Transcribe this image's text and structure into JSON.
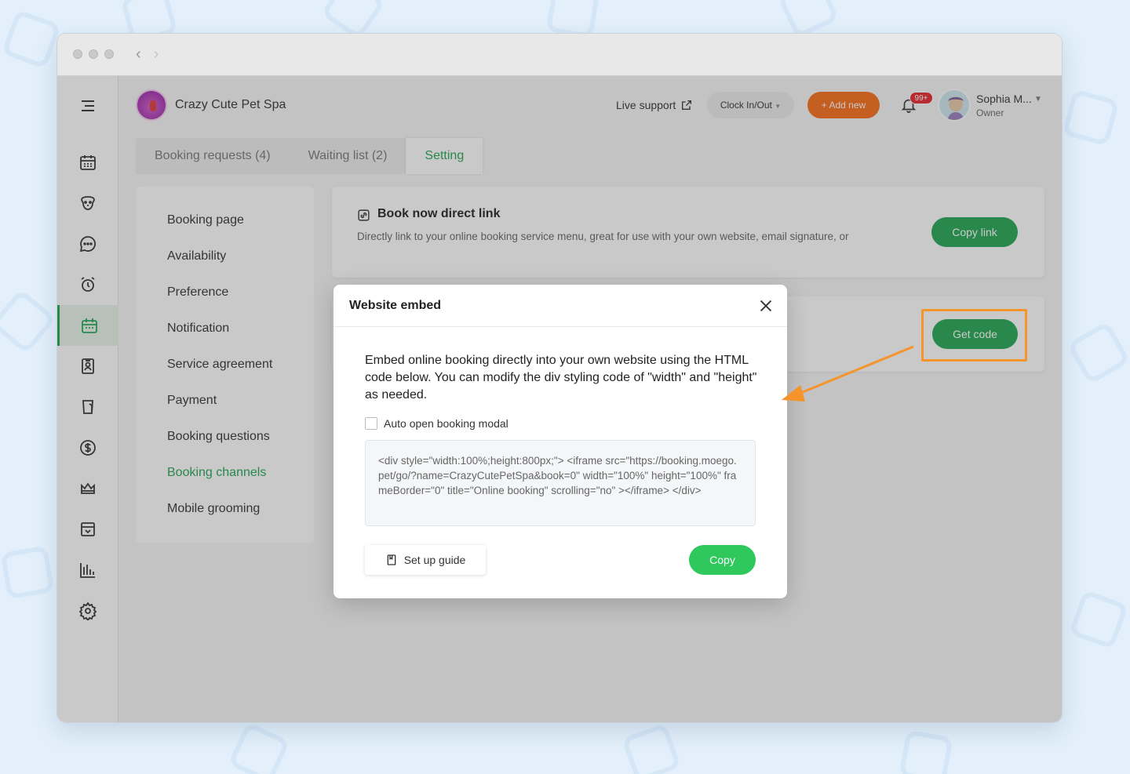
{
  "business": {
    "name": "Crazy Cute Pet Spa"
  },
  "header": {
    "live_support": "Live support",
    "clock_label": "Clock In/Out",
    "add_new_label": "+ Add new",
    "notification_badge": "99+",
    "user_name": "Sophia M...",
    "user_role": "Owner"
  },
  "tabs": [
    {
      "label": "Booking requests (4)"
    },
    {
      "label": "Waiting list (2)"
    },
    {
      "label": "Setting"
    }
  ],
  "settings_menu": [
    {
      "label": "Booking page"
    },
    {
      "label": "Availability"
    },
    {
      "label": "Preference"
    },
    {
      "label": "Notification"
    },
    {
      "label": "Service agreement"
    },
    {
      "label": "Payment"
    },
    {
      "label": "Booking questions"
    },
    {
      "label": "Booking channels"
    },
    {
      "label": "Mobile grooming"
    }
  ],
  "direct_link_card": {
    "title": "Book now direct link",
    "description": "Directly link to your online booking service menu, great for use with your own website, email signature, or",
    "button": "Copy link"
  },
  "embed_card": {
    "button": "Get code"
  },
  "modal": {
    "title": "Website embed",
    "description": "Embed online booking directly into your own website using the HTML code below. You can modify the div styling code of \"width\" and \"height\" as needed.",
    "checkbox_label": "Auto open booking modal",
    "code": "<div style=\"width:100%;height:800px;\"> <iframe src=\"https://booking.moego.pet/go/?name=CrazyCutePetSpa&book=0\" width=\"100%\" height=\"100%\" frameBorder=\"0\" title=\"Online booking\" scrolling=\"no\" ></iframe> </div>",
    "guide_label": "Set up guide",
    "copy_label": "Copy"
  },
  "colors": {
    "brand_green": "#22a653",
    "accent_orange": "#f96b17",
    "highlight_orange": "#f5942b"
  }
}
